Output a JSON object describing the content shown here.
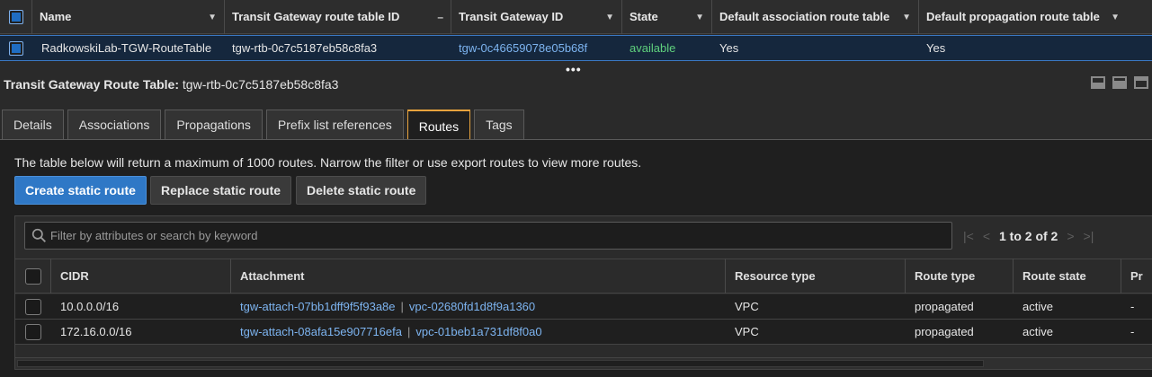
{
  "top_table": {
    "columns": [
      {
        "label": "Name",
        "sort": "arrow"
      },
      {
        "label": "Transit Gateway route table ID",
        "sort": "dash"
      },
      {
        "label": "Transit Gateway ID",
        "sort": "arrow"
      },
      {
        "label": "State",
        "sort": "arrow"
      },
      {
        "label": "Default association route table",
        "sort": "arrow"
      },
      {
        "label": "Default propagation route table",
        "sort": "arrow"
      }
    ],
    "row": {
      "name": "RadkowskiLab-TGW-RouteTable",
      "route_table_id": "tgw-rtb-0c7c5187eb58c8fa3",
      "tgw_id": "tgw-0c46659078e05b68f",
      "state": "available",
      "default_association": "Yes",
      "default_propagation": "Yes"
    }
  },
  "resize_handle": "•••",
  "panel": {
    "title_label": "Transit Gateway Route Table:",
    "title_value": " tgw-rtb-0c7c5187eb58c8fa3",
    "tabs": [
      "Details",
      "Associations",
      "Propagations",
      "Prefix list references",
      "Routes",
      "Tags"
    ],
    "active_tab": "Routes",
    "info_text": "The table below will return a maximum of 1000 routes. Narrow the filter or use export routes to view more routes.",
    "buttons": {
      "create": "Create static route",
      "replace": "Replace static route",
      "delete": "Delete static route"
    },
    "search_placeholder": "Filter by attributes or search by keyword",
    "pager": {
      "first": "|<",
      "prev": "<",
      "text": "1 to 2 of 2",
      "next": ">",
      "last": ">|"
    },
    "routes_columns": [
      "CIDR",
      "Attachment",
      "Resource type",
      "Route type",
      "Route state",
      "Pr"
    ],
    "routes": [
      {
        "cidr": "10.0.0.0/16",
        "attachment": "tgw-attach-07bb1dff9f5f93a8e",
        "separator": "|",
        "vpc": "vpc-02680fd1d8f9a1360",
        "resource_type": "VPC",
        "route_type": "propagated",
        "route_state": "active",
        "extra": "-"
      },
      {
        "cidr": "172.16.0.0/16",
        "attachment": "tgw-attach-08afa15e907716efa",
        "separator": "|",
        "vpc": "vpc-01beb1a731df8f0a0",
        "resource_type": "VPC",
        "route_type": "propagated",
        "route_state": "active",
        "extra": "-"
      }
    ]
  },
  "icons": [
    "checkbox",
    "sort-arrow-icon",
    "search-icon",
    "pager-first-icon",
    "pager-prev-icon",
    "pager-next-icon",
    "pager-last-icon",
    "panel-layout-icon"
  ],
  "colors": {
    "accent": "#2f78c6",
    "active_tab": "#e8a33d",
    "link": "#7db4f0",
    "status_available": "#5fd07d"
  }
}
